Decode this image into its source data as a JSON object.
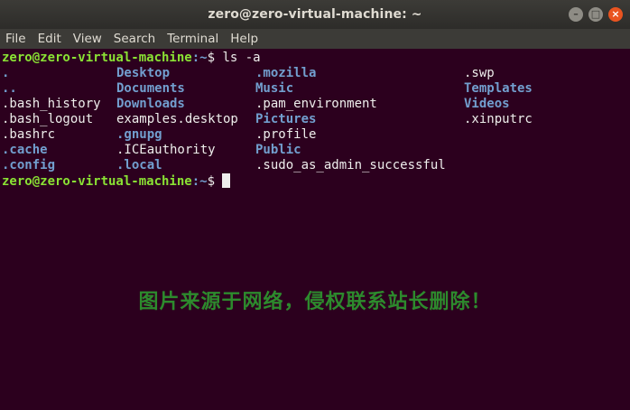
{
  "window": {
    "title": "zero@zero-virtual-machine: ~",
    "controls": [
      "minimize",
      "maximize",
      "close"
    ]
  },
  "menu": [
    "File",
    "Edit",
    "View",
    "Search",
    "Terminal",
    "Help"
  ],
  "terminal": {
    "prompt_user": "zero@zero-virtual-machine",
    "prompt_path": ":~",
    "prompt_symbol": "$",
    "command": " ls -a",
    "listing_rows": [
      [
        {
          "name": ".",
          "dir": true
        },
        {
          "name": "Desktop",
          "dir": true
        },
        {
          "name": ".mozilla",
          "dir": true
        },
        {
          "name": ".swp",
          "dir": false
        }
      ],
      [
        {
          "name": "..",
          "dir": true
        },
        {
          "name": "Documents",
          "dir": true
        },
        {
          "name": "Music",
          "dir": true
        },
        {
          "name": "Templates",
          "dir": true
        }
      ],
      [
        {
          "name": ".bash_history",
          "dir": false
        },
        {
          "name": "Downloads",
          "dir": true
        },
        {
          "name": ".pam_environment",
          "dir": false
        },
        {
          "name": "Videos",
          "dir": true
        }
      ],
      [
        {
          "name": ".bash_logout",
          "dir": false
        },
        {
          "name": "examples.desktop",
          "dir": false
        },
        {
          "name": "Pictures",
          "dir": true
        },
        {
          "name": ".xinputrc",
          "dir": false
        }
      ],
      [
        {
          "name": ".bashrc",
          "dir": false
        },
        {
          "name": ".gnupg",
          "dir": true
        },
        {
          "name": ".profile",
          "dir": false
        },
        {
          "name": "",
          "dir": false
        }
      ],
      [
        {
          "name": ".cache",
          "dir": true
        },
        {
          "name": ".ICEauthority",
          "dir": false
        },
        {
          "name": "Public",
          "dir": true
        },
        {
          "name": "",
          "dir": false
        }
      ],
      [
        {
          "name": ".config",
          "dir": true
        },
        {
          "name": ".local",
          "dir": true
        },
        {
          "name": ".sudo_as_admin_successful",
          "dir": false
        },
        {
          "name": "",
          "dir": false
        }
      ]
    ]
  },
  "watermark": "图片来源于网络，侵权联系站长删除！",
  "colors": {
    "background": "#2c001e",
    "prompt_user": "#8ae234",
    "directory": "#729fcf",
    "file": "#eeeeec",
    "watermark": "#2d8a2d"
  }
}
